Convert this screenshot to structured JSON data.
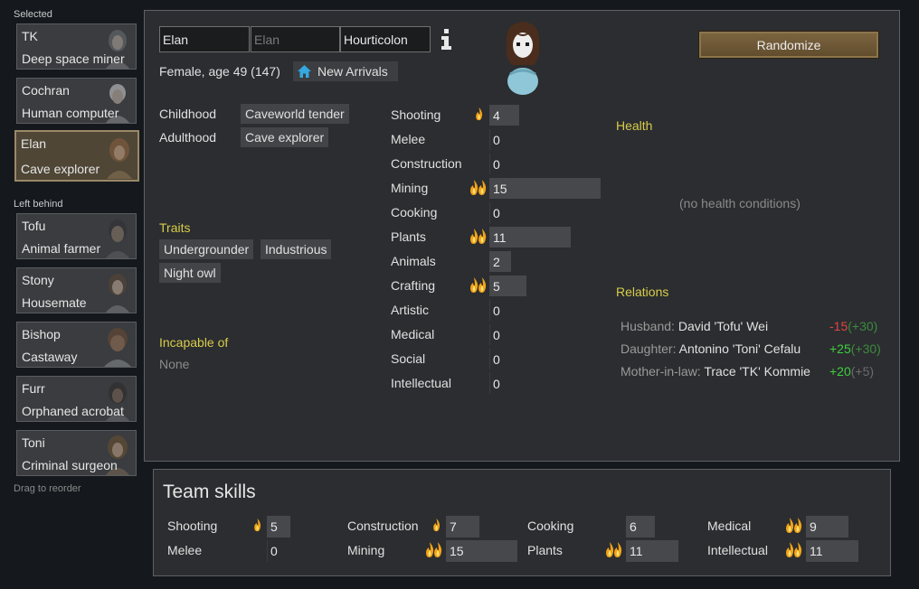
{
  "left": {
    "selected_label": "Selected",
    "left_behind_label": "Left behind",
    "drag_hint": "Drag to reorder",
    "selected": [
      {
        "name": "TK",
        "title": "Deep space miner"
      },
      {
        "name": "Cochran",
        "title": "Human computer"
      },
      {
        "name": "Elan",
        "title": "Cave explorer"
      }
    ],
    "left_behind": [
      {
        "name": "Tofu",
        "title": "Animal farmer"
      },
      {
        "name": "Stony",
        "title": "Housemate"
      },
      {
        "name": "Bishop",
        "title": "Castaway"
      },
      {
        "name": "Furr",
        "title": "Orphaned acrobat"
      },
      {
        "name": "Toni",
        "title": "Criminal surgeon"
      }
    ]
  },
  "pawn": {
    "first_name": "Elan",
    "nick_placeholder": "Elan",
    "last_name": "Hourticolon",
    "gender_age": "Female, age 49 (147)",
    "faction": "New Arrivals",
    "randomize_label": "Randomize"
  },
  "backstory": {
    "childhood_label": "Childhood",
    "childhood": "Caveworld tender",
    "adulthood_label": "Adulthood",
    "adulthood": "Cave explorer"
  },
  "traits": {
    "heading": "Traits",
    "items": [
      "Undergrounder",
      "Industrious",
      "Night owl"
    ]
  },
  "incapable": {
    "heading": "Incapable of",
    "value": "None"
  },
  "skills": [
    {
      "name": "Shooting",
      "level": 4,
      "passion": "minor"
    },
    {
      "name": "Melee",
      "level": 0,
      "passion": "none"
    },
    {
      "name": "Construction",
      "level": 0,
      "passion": "none"
    },
    {
      "name": "Mining",
      "level": 15,
      "passion": "major"
    },
    {
      "name": "Cooking",
      "level": 0,
      "passion": "none"
    },
    {
      "name": "Plants",
      "level": 11,
      "passion": "major"
    },
    {
      "name": "Animals",
      "level": 2,
      "passion": "none"
    },
    {
      "name": "Crafting",
      "level": 5,
      "passion": "major"
    },
    {
      "name": "Artistic",
      "level": 0,
      "passion": "none"
    },
    {
      "name": "Medical",
      "level": 0,
      "passion": "none"
    },
    {
      "name": "Social",
      "level": 0,
      "passion": "none"
    },
    {
      "name": "Intellectual",
      "level": 0,
      "passion": "none"
    }
  ],
  "health": {
    "heading": "Health",
    "empty": "(no health conditions)"
  },
  "relations": {
    "heading": "Relations",
    "items": [
      {
        "type": "Husband:",
        "name": "David 'Tofu' Wei",
        "opinion": "-15",
        "base": "(+30)"
      },
      {
        "type": "Daughter:",
        "name": "Antonino 'Toni' Cefalu",
        "opinion": "+25",
        "base": "(+30)"
      },
      {
        "type": "Mother-in-law:",
        "name": "Trace 'TK' Kommie",
        "opinion": "+20",
        "base": "(+5)"
      }
    ]
  },
  "team": {
    "title": "Team skills",
    "skills": [
      {
        "name": "Shooting",
        "level": 5,
        "passion": "minor"
      },
      {
        "name": "Melee",
        "level": 0,
        "passion": "none"
      },
      {
        "name": "Construction",
        "level": 7,
        "passion": "minor"
      },
      {
        "name": "Mining",
        "level": 15,
        "passion": "major"
      },
      {
        "name": "Cooking",
        "level": 6,
        "passion": "none"
      },
      {
        "name": "Plants",
        "level": 11,
        "passion": "major"
      },
      {
        "name": "Medical",
        "level": 9,
        "passion": "major"
      },
      {
        "name": "Intellectual",
        "level": 11,
        "passion": "major"
      }
    ]
  },
  "colors": {
    "accent_yellow": "#d8cc4a",
    "negative": "#e04444",
    "positive": "#3fcf3f",
    "selected_border": "#9b8867",
    "button": "#6e5735"
  }
}
